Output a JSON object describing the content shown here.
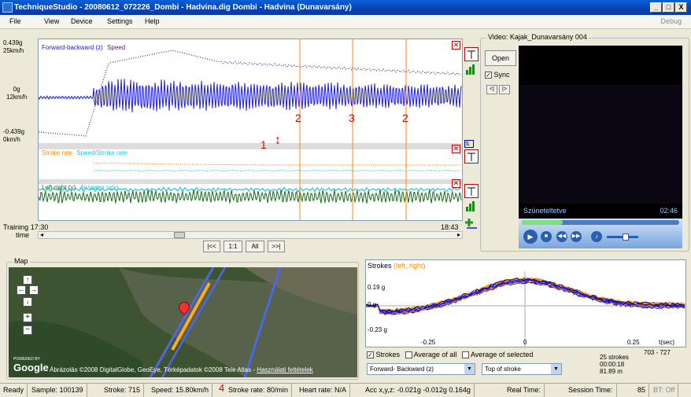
{
  "window": {
    "title": "TechniqueStudio - 20080612_072226_Dombi - Hadvina.dig  Dombi - Hadvina (Dunavarsány)",
    "min": "_",
    "max": "□",
    "close": "X"
  },
  "menu": {
    "items": [
      "File",
      "View",
      "Device",
      "Settings",
      "Help"
    ],
    "debug": "Debug"
  },
  "graph": {
    "top_axis": {
      "l1": "0.439g",
      "l2": "25km/h",
      "l3": "0g",
      "l4": "12km/h",
      "l5": "-0.439g",
      "l6": "0km/h"
    },
    "series_top_1": "Forward-backward (z)",
    "series_top_2": "Speed",
    "series_mid_1": "Stroke rate",
    "series_mid_2": "Speed/Stroke rate",
    "series_bot_1": "Left-right (y)",
    "series_bot_2": "Air/water ratio",
    "training_label": "Training",
    "time_label": "time",
    "start_time": "17:30",
    "end_time": "18:43",
    "annotations": {
      "a1": "1",
      "a2": "2",
      "a3": "3",
      "a4": "2",
      "a5": "4"
    }
  },
  "nav": {
    "first": "|<<",
    "one": "1:1",
    "all": "All",
    "last": ">>|"
  },
  "video": {
    "group": "Video: Kajak_Dunavarsány 004",
    "open": "Open",
    "sync": "Sync",
    "prev": "<|",
    "next": "|>",
    "status": "Szüneteltetve",
    "time": "02:46"
  },
  "map": {
    "group": "Map",
    "credits": "Ábrázolás ©2008 DigitalGlobe, GeoEye, Térképadatok ©2008 Tele Atlas",
    "terms": "Használati feltételek",
    "powered_by": "POWERED BY",
    "google": "Google"
  },
  "strokes": {
    "title": "Strokes",
    "legend": "(left, right)",
    "y1": "0.19 g",
    "y2": "0 g",
    "y3": "-0.23 g",
    "x1": "-0.25",
    "x2": "0",
    "x3": "0.25",
    "xunit": "t(sec)",
    "range": "703 - 727",
    "chk_strokes": "Strokes",
    "chk_avg_all": "Average of all",
    "chk_avg_sel": "Average of selected",
    "select1": "Forward- Backward (z)",
    "select2": "Top of stroke",
    "count": "25 strokes",
    "duration": "00:00:18",
    "distance": "81.89 m"
  },
  "status": {
    "ready": "Ready",
    "sample": "Sample: 100139",
    "stroke": "Stroke: 715",
    "speed": "Speed: 15.80km/h",
    "stroke_rate": "Stroke rate: 80/min",
    "heart": "Heart rate: N/A",
    "acc": "Acc x,y,z: -0.021g  -0.012g  0.164g",
    "real": "Real Time:",
    "session": "Session Time:",
    "num": "85",
    "bt": "BT: Off"
  },
  "colors": {
    "blue": "#1a1adc",
    "purple": "#5a1a6a",
    "orange": "#ff8a00",
    "cyan": "#22c8d8",
    "green": "#1a6a1a",
    "annotation": "#e00000"
  }
}
